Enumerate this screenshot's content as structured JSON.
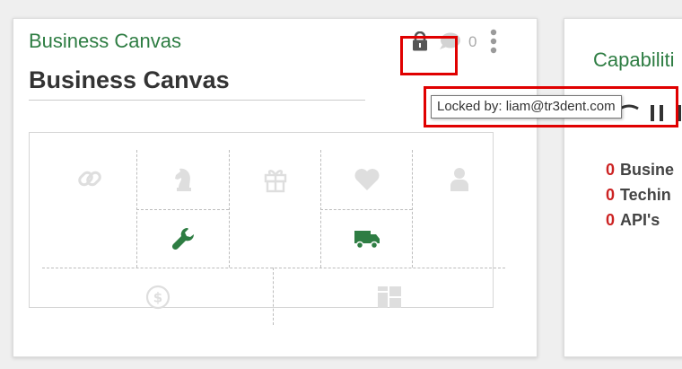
{
  "main_card": {
    "subtitle": "Business Canvas",
    "title": "Business Canvas",
    "comment_count": "0",
    "tooltip": "Locked by: liam@tr3dent.com"
  },
  "canvas_icons": {
    "key_partners": "link-icon",
    "key_activities": "chess-knight-icon",
    "key_resources": "wrench-icon",
    "value_propositions": "gift-icon",
    "customer_relationships": "heart-icon",
    "channels": "truck-icon",
    "customer_segments": "person-icon",
    "cost_structure": "dollar-icon",
    "revenue_streams": "grid-icon"
  },
  "side_card": {
    "subtitle": "Capabiliti",
    "items": [
      {
        "count": "0",
        "label": "Busine"
      },
      {
        "count": "0",
        "label": "Techin"
      },
      {
        "count": "0",
        "label": "API's"
      }
    ]
  },
  "colors": {
    "accent_green": "#2e7d43",
    "highlight_red": "#e00000",
    "count_red": "#cc2222",
    "icon_gray": "#dedede"
  }
}
